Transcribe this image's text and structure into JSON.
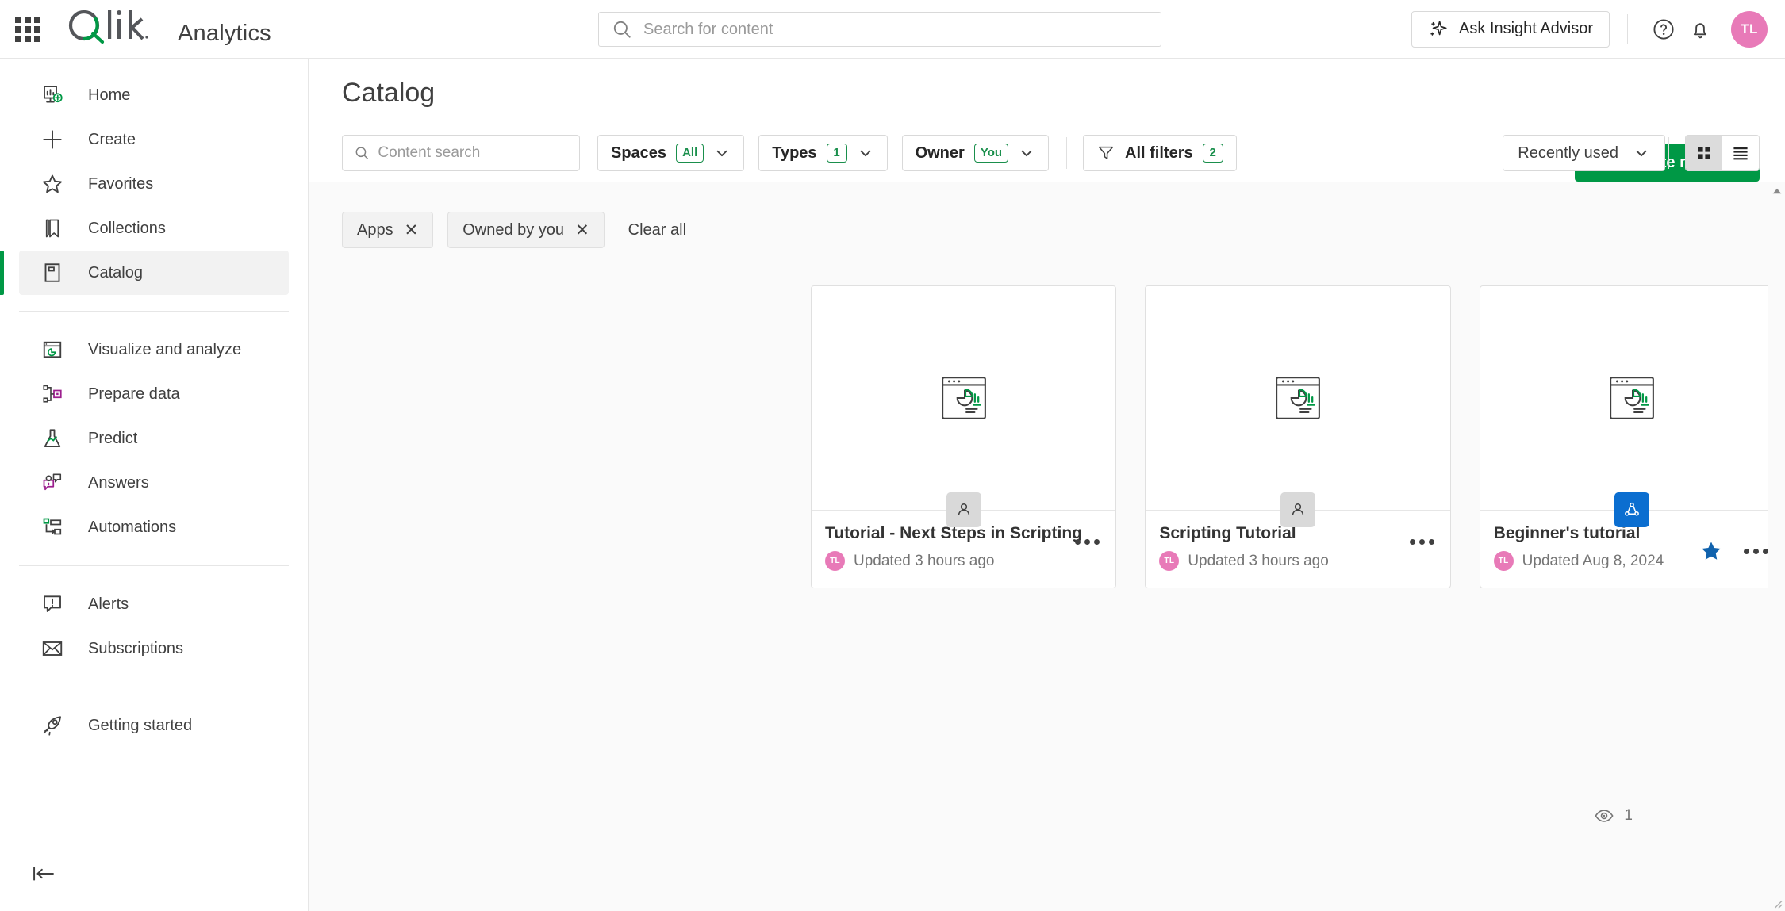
{
  "topbar": {
    "waffle_label": "app-launcher",
    "brand": "Analytics",
    "search": {
      "placeholder": "Search for content",
      "value": ""
    },
    "ask_insight_advisor": "Ask Insight Advisor",
    "help_icon": "help-circle-icon",
    "notifications_icon": "bell-icon",
    "avatar_initials": "TL"
  },
  "sidebar": {
    "items": [
      {
        "label": "Home",
        "icon": "home-chart-icon",
        "active": false
      },
      {
        "label": "Create",
        "icon": "plus-icon",
        "active": false
      },
      {
        "label": "Favorites",
        "icon": "star-outline-icon",
        "active": false
      },
      {
        "label": "Collections",
        "icon": "bookmark-icon",
        "active": false
      },
      {
        "label": "Catalog",
        "icon": "catalog-book-icon",
        "active": true
      },
      {
        "label": "Visualize and analyze",
        "icon": "visualize-icon",
        "active": false
      },
      {
        "label": "Prepare data",
        "icon": "prepare-data-icon",
        "active": false
      },
      {
        "label": "Predict",
        "icon": "flask-icon",
        "active": false
      },
      {
        "label": "Answers",
        "icon": "answers-chat-icon",
        "active": false
      },
      {
        "label": "Automations",
        "icon": "automations-icon",
        "active": false
      },
      {
        "label": "Alerts",
        "icon": "alert-bubble-icon",
        "active": false
      },
      {
        "label": "Subscriptions",
        "icon": "envelope-icon",
        "active": false
      },
      {
        "label": "Getting started",
        "icon": "rocket-icon",
        "active": false
      }
    ],
    "collapse_icon": "collapse-left-icon"
  },
  "page": {
    "title": "Catalog",
    "create_new": "Create new"
  },
  "toolbar": {
    "content_search_placeholder": "Content search",
    "content_search_value": "",
    "filters": [
      {
        "label": "Spaces",
        "badge": "All"
      },
      {
        "label": "Types",
        "badge": "1"
      },
      {
        "label": "Owner",
        "badge": "You"
      }
    ],
    "all_filters": {
      "label": "All filters",
      "badge": "2",
      "icon": "funnel-icon"
    },
    "sort": {
      "value": "Recently used"
    },
    "view_modes": [
      {
        "name": "grid",
        "icon": "grid-view-icon",
        "active": true
      },
      {
        "name": "list",
        "icon": "list-view-icon",
        "active": false
      }
    ]
  },
  "chips": {
    "items": [
      {
        "label": "Apps"
      },
      {
        "label": "Owned by you"
      }
    ],
    "clear_all": "Clear all"
  },
  "cards": [
    {
      "title": "Tutorial - Next Steps in Scripting",
      "updated": "Updated 3 hours ago",
      "owner_initials": "TL",
      "space": "personal",
      "space_icon": "person-icon",
      "thumb_icon": "app-chart-icon",
      "favorite": false
    },
    {
      "title": "Scripting Tutorial",
      "updated": "Updated 3 hours ago",
      "owner_initials": "TL",
      "space": "personal",
      "space_icon": "person-icon",
      "thumb_icon": "app-chart-icon",
      "favorite": false
    },
    {
      "title": "Beginner's tutorial",
      "updated": "Updated Aug 8, 2024",
      "owner_initials": "TL",
      "space": "shared",
      "space_icon": "shared-space-icon",
      "thumb_icon": "app-chart-icon",
      "favorite": true
    }
  ],
  "footer": {
    "views_icon": "eye-icon",
    "views_count": "1"
  },
  "colors": {
    "brand_green": "#009845",
    "badge_green": "#1a8f4c",
    "avatar_pink": "#e87ab8",
    "shared_blue": "#0b6ed0",
    "favorite_blue": "#1062ad"
  }
}
